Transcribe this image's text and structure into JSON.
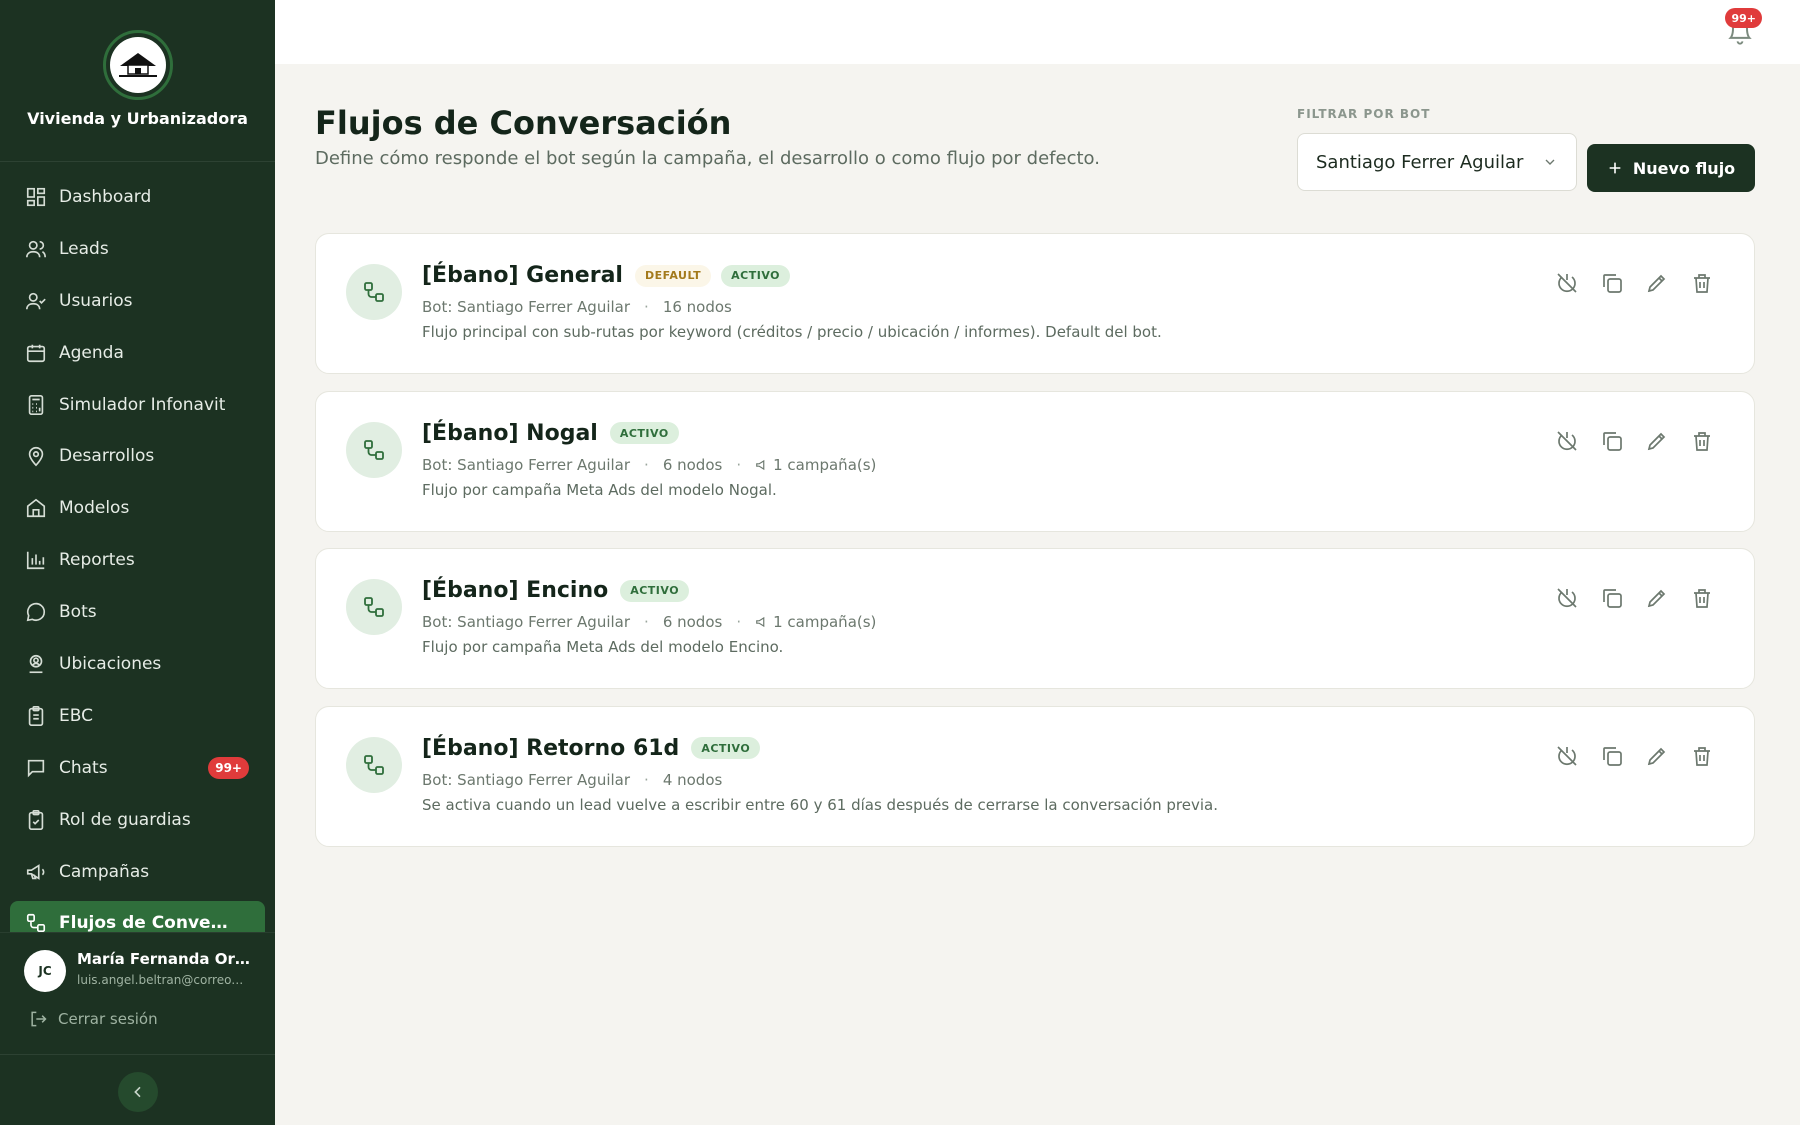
{
  "brand": {
    "name": "Vivienda y Urbanizadora"
  },
  "nav": {
    "items": [
      {
        "label": "Dashboard",
        "icon": "dashboard-icon"
      },
      {
        "label": "Leads",
        "icon": "users-icon"
      },
      {
        "label": "Usuarios",
        "icon": "user-check-icon"
      },
      {
        "label": "Agenda",
        "icon": "calendar-icon"
      },
      {
        "label": "Simulador Infonavit",
        "icon": "calculator-icon"
      },
      {
        "label": "Desarrollos",
        "icon": "map-pin-icon"
      },
      {
        "label": "Modelos",
        "icon": "home-icon"
      },
      {
        "label": "Reportes",
        "icon": "bar-chart-icon"
      },
      {
        "label": "Bots",
        "icon": "message-circle-icon"
      },
      {
        "label": "Ubicaciones",
        "icon": "user-location-icon"
      },
      {
        "label": "EBC",
        "icon": "clipboard-icon"
      },
      {
        "label": "Chats",
        "icon": "chat-icon",
        "badge": "99+"
      },
      {
        "label": "Rol de guardias",
        "icon": "clipboard-check-icon"
      },
      {
        "label": "Campañas",
        "icon": "megaphone-icon"
      },
      {
        "label": "Flujos de Conversación",
        "icon": "workflow-icon",
        "active": true
      }
    ]
  },
  "user": {
    "initials": "JC",
    "name": "María Fernanda Ortega",
    "email": "luis.angel.beltran@correo.com",
    "logout_label": "Cerrar sesión"
  },
  "topbar": {
    "notification_count": "99+"
  },
  "header": {
    "title": "Flujos de Conversación",
    "subtitle": "Define cómo responde el bot según la campaña, el desarrollo o como flujo por defecto.",
    "filter_label": "FILTRAR POR BOT",
    "filter_value": "Santiago Ferrer Aguilar",
    "new_button_label": "Nuevo flujo"
  },
  "flows": [
    {
      "title": "[Ébano] General",
      "badges": [
        "DEFAULT",
        "ACTIVO"
      ],
      "bot": "Bot: Santiago Ferrer Aguilar",
      "nodes": "16 nodos",
      "campaigns": "",
      "description": "Flujo principal con sub-rutas por keyword (créditos / precio / ubicación / informes). Default del bot."
    },
    {
      "title": "[Ébano] Nogal",
      "badges": [
        "ACTIVO"
      ],
      "bot": "Bot: Santiago Ferrer Aguilar",
      "nodes": "6 nodos",
      "campaigns": "1 campaña(s)",
      "description": "Flujo por campaña Meta Ads del modelo Nogal."
    },
    {
      "title": "[Ébano] Encino",
      "badges": [
        "ACTIVO"
      ],
      "bot": "Bot: Santiago Ferrer Aguilar",
      "nodes": "6 nodos",
      "campaigns": "1 campaña(s)",
      "description": "Flujo por campaña Meta Ads del modelo Encino."
    },
    {
      "title": "[Ébano] Retorno 61d",
      "badges": [
        "ACTIVO"
      ],
      "bot": "Bot: Santiago Ferrer Aguilar",
      "nodes": "4 nodos",
      "campaigns": "",
      "description": "Se activa cuando un lead vuelve a escribir entre 60 y 61 días después de cerrarse la conversación previa."
    }
  ],
  "colors": {
    "sidebar": "#1c3222",
    "accent": "#2f6e3b",
    "badge_red": "#e03b3b",
    "active_badge": "#dcefdd",
    "default_badge": "#fbf6e8"
  }
}
